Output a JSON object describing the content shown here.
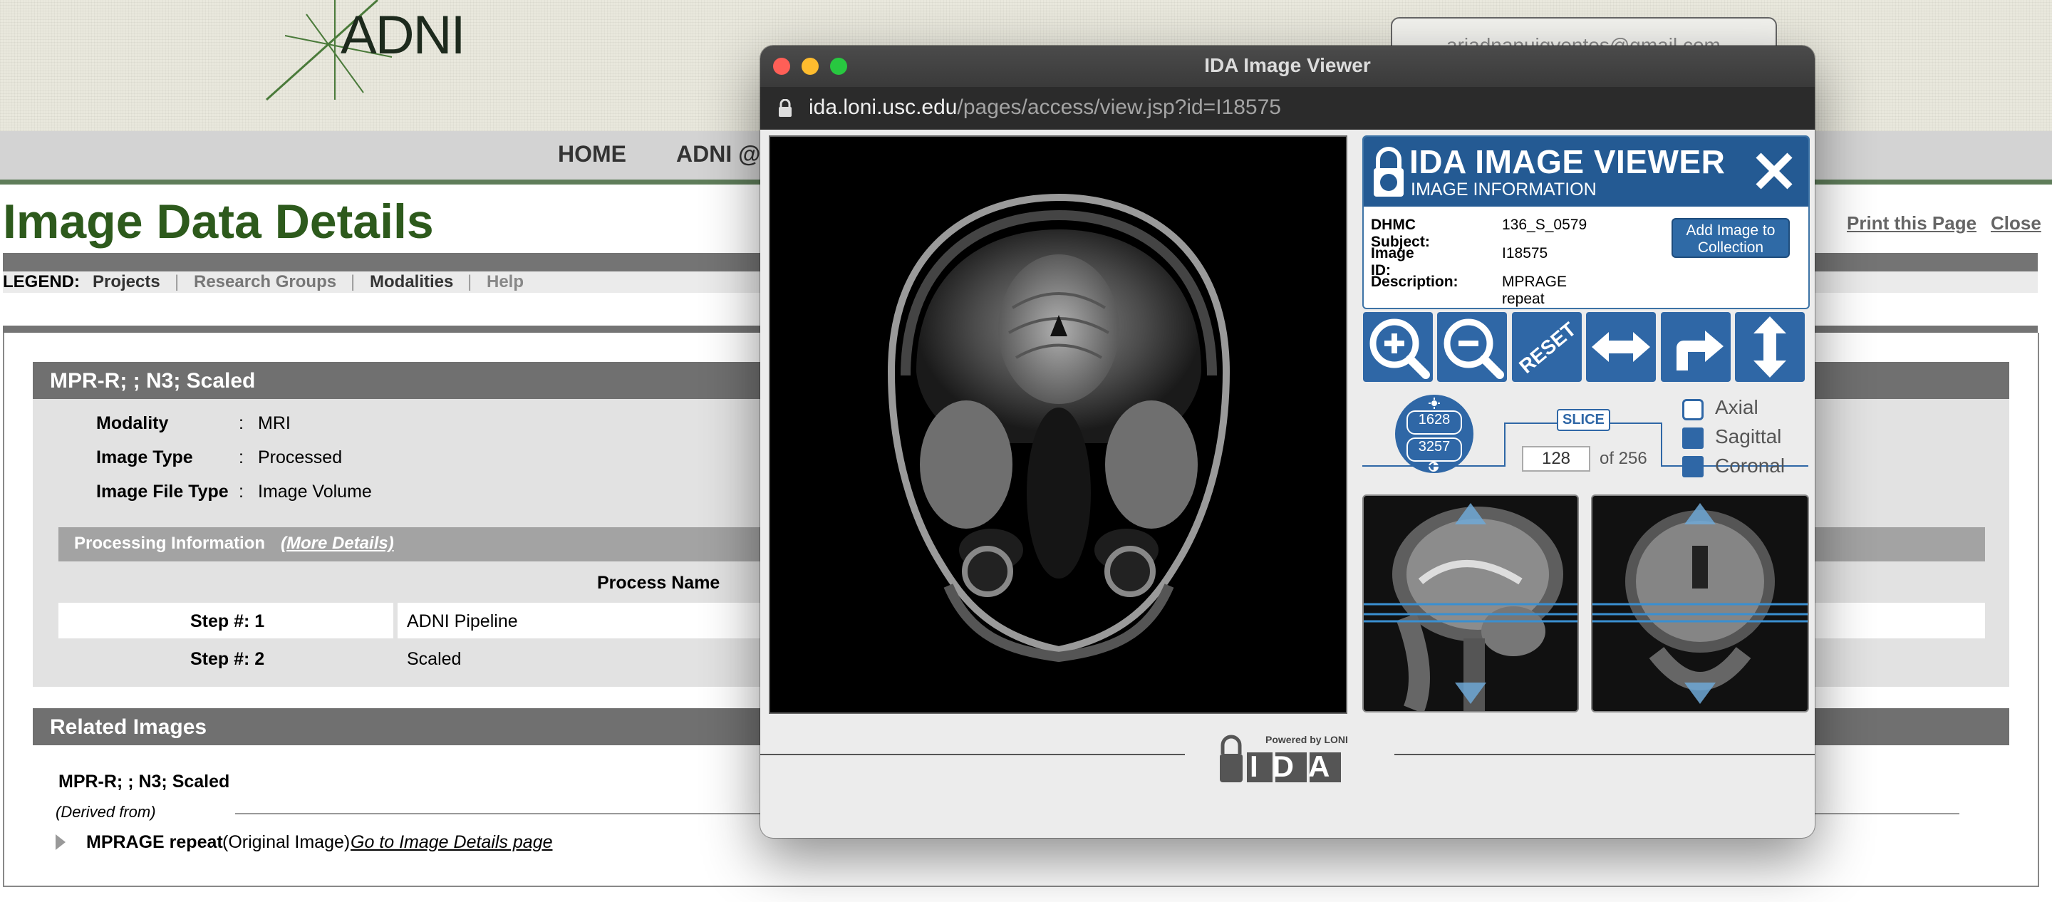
{
  "site": {
    "logo_text": "ADNI",
    "user_email": "ariadnapuigventos@gmail.com",
    "nav": [
      "HOME",
      "ADNI @"
    ]
  },
  "page": {
    "title": "Image Data Details",
    "print_link": "Print this Page",
    "close_link": "Close",
    "legend_label": "LEGEND",
    "legend_items": [
      "Projects",
      "Research Groups",
      "Modalities",
      "Help"
    ]
  },
  "image_section": {
    "header": "MPR-R; ; N3; Scaled",
    "fields": [
      {
        "label": "Modality",
        "value": "MRI"
      },
      {
        "label": "Image Type",
        "value": "Processed"
      },
      {
        "label": "Image File Type",
        "value": "Image Volume"
      }
    ],
    "processing_label": "Processing Information",
    "more_details_link": "(More Details)",
    "process_name_header": "Process Name",
    "steps": [
      {
        "label": "Step #: 1",
        "name": "ADNI Pipeline"
      },
      {
        "label": "Step #: 2",
        "name": "Scaled"
      }
    ]
  },
  "related_images": {
    "header": "Related Images",
    "item_title": "MPR-R; ; N3; Scaled",
    "derived_from": "(Derived from)",
    "original_name": "MPRAGE repeat",
    "original_note": "(Original Image)",
    "details_link": "Go to Image Details page"
  },
  "popup": {
    "window_title": "IDA Image Viewer",
    "url_host": "ida.loni.usc.edu",
    "url_path": "/pages/access/view.jsp?id=I18575",
    "panel_title": "IDA IMAGE VIEWER",
    "panel_subtitle": "IMAGE INFORMATION",
    "info": [
      {
        "label": "DHMC Subject:",
        "value": "136_S_0579"
      },
      {
        "label": "Image ID:",
        "value": "I18575"
      },
      {
        "label": "Description:",
        "value": "MPRAGE repeat"
      }
    ],
    "add_button": "Add Image to Collection",
    "tools": [
      "zoom-in",
      "zoom-out",
      "reset",
      "flip-horizontal",
      "rotate",
      "flip-vertical"
    ],
    "reset_label": "RESET",
    "brightness": "1628",
    "contrast": "3257",
    "slice_label": "SLICE",
    "slice_value": "128",
    "slice_total": "of 256",
    "view_options": [
      {
        "label": "Axial",
        "selected": true
      },
      {
        "label": "Sagittal",
        "selected": false
      },
      {
        "label": "Coronal",
        "selected": false
      }
    ],
    "footer_powered": "Powered by LONI",
    "footer_brand": "IDA",
    "accent_color": "#2f67a6"
  }
}
